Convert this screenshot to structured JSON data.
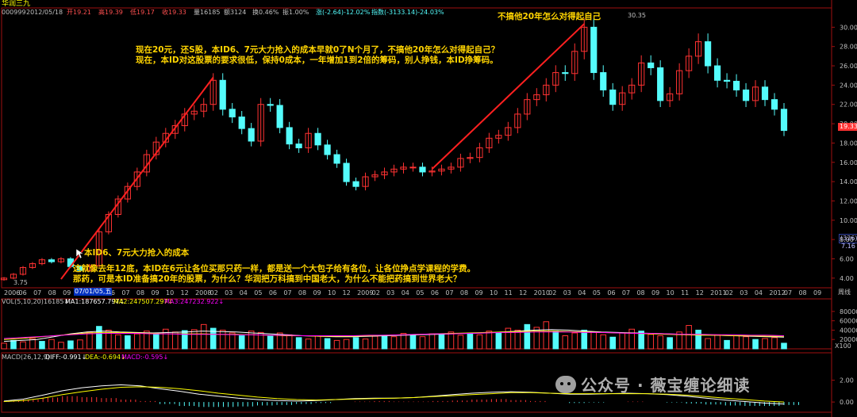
{
  "header": {
    "title": "华润三九",
    "code": "000999",
    "date": "2012/05/18",
    "open": "开19.21",
    "high": "高19.39",
    "low": "低19.17",
    "close": "收19.33",
    "volume": "量16185",
    "amount": "额3124",
    "turnover": "换0.46%",
    "amplitude": "振1.00%",
    "change": "涨(-2.64)-12.02%",
    "index": "指数(-3133.14)-24.03%"
  },
  "colors": {
    "up": "#ff3232",
    "down": "#54fcfc",
    "ma1": "#ffffff",
    "ma2": "#ffff00",
    "ma3": "#ff00ff",
    "trend": "#ff2020",
    "annotation": "#ffd400"
  },
  "annotations": {
    "top_line1": "现在20元，还S股，本ID6、7元大力抢入的成本早就0了N个月了，不搞他20年怎么对得起自己？",
    "top_line2": "现在，本ID对这股票的要求很低，保持0成本，一年增加1到2倍的筹码，别人挣钱，本ID挣筹码。",
    "peak_note": "不搞他20年怎么对得起自己",
    "entry_note": "本ID6、7元大力抢入的成本",
    "bottom_line1": "这就像去年12底，本ID在6元让各位买那只药一样，都是送一个大包子给有各位，让各位挣点学课程的学费。",
    "bottom_line2": "那药，可是本ID准备搞20年的股票，为什么？华润把万科搞到中国老大，为什么不能把药搞到世界老大？",
    "high_value": "30.35",
    "low_value": "3.75"
  },
  "price_badge": "19.33",
  "period_label": "(326)",
  "period_value": "7.16",
  "cursor_date": "07/01/05,五",
  "vol_panel": {
    "title": "VOL(5,10,20)",
    "value": "16185↓",
    "ma1": "MA1:187657.797↓",
    "ma2": "MA2:247507.297↓",
    "ma3": "MA3:247232.922↓",
    "scale_unit": "X100"
  },
  "macd_panel": {
    "title": "MACD(26,12,9)",
    "diff": "DIFF:-0.991↓",
    "dea": "DEA:-0.694↓",
    "macd": "MACD:-0.595↓"
  },
  "right_unit": "周线",
  "watermark": "公众号 · 薇宝缠论细读",
  "chart_data": [
    {
      "type": "candlestick",
      "title": "华润三九 周线",
      "ylim": [
        3,
        32
      ],
      "y_ticks": [
        "30.00",
        "28.00",
        "26.00",
        "24.00",
        "22.00",
        "20.00",
        "18.00",
        "16.00",
        "14.00",
        "12.00",
        "10.00",
        "8.00",
        "6.00",
        "4.00"
      ],
      "x_ticks": [
        "2006",
        "06",
        "07",
        "08",
        "09",
        "07/01/05,五",
        "05",
        "06",
        "07",
        "08",
        "09",
        "10",
        "12",
        "2008",
        "02",
        "03",
        "04",
        "05",
        "06",
        "07",
        "08",
        "09",
        "10",
        "12",
        "2009",
        "02",
        "03",
        "04",
        "05",
        "06",
        "07",
        "08",
        "09",
        "10",
        "11",
        "12",
        "2010",
        "02",
        "03",
        "04",
        "05",
        "06",
        "07",
        "08",
        "09",
        "10",
        "11",
        "12",
        "2011",
        "02",
        "03",
        "04",
        "2012",
        "07",
        "08",
        "09"
      ],
      "series": [
        {
          "name": "收盘",
          "values": [
            4.0,
            4.4,
            5.1,
            5.5,
            5.9,
            5.7,
            6.0,
            5.2,
            4.8,
            5.3,
            8.8,
            10.6,
            12.2,
            13.5,
            15.0,
            16.8,
            18.1,
            19.0,
            19.8,
            21.0,
            21.3,
            22.0,
            24.5,
            21.5,
            20.7,
            19.5,
            18.2,
            22.0,
            21.9,
            19.6,
            17.9,
            17.5,
            19.0,
            17.8,
            16.8,
            15.9,
            14.0,
            13.5,
            14.5,
            14.7,
            15.0,
            15.3,
            15.5,
            15.5,
            15.0,
            15.1,
            15.3,
            15.5,
            16.4,
            16.5,
            17.5,
            18.5,
            18.8,
            19.6,
            21.0,
            22.5,
            23.0,
            24.0,
            25.3,
            25.2,
            27.5,
            30.0,
            25.3,
            23.5,
            22.0,
            23.2,
            24.0,
            26.3,
            25.8,
            22.4,
            23.1,
            25.5,
            27.0,
            28.5,
            26.0,
            24.5,
            24.4,
            23.5,
            22.4,
            23.8,
            22.5,
            21.5,
            19.3
          ]
        }
      ],
      "trend_lines": [
        {
          "from": [
            3.8,
            "2006-09"
          ],
          "to": [
            24.6,
            "2007-09"
          ]
        },
        {
          "from": [
            15.4,
            "2009-09"
          ],
          "to": [
            30.35,
            "2010-05"
          ]
        }
      ]
    },
    {
      "type": "bar",
      "title": "VOL(5,10,20)",
      "y_ticks": [
        "80000",
        "60000",
        "40000",
        "20000"
      ],
      "ylim": [
        0,
        95000
      ],
      "series": [
        {
          "name": "VOL",
          "values": [
            12000,
            18000,
            15000,
            22000,
            16000,
            20000,
            14000,
            17000,
            19000,
            36000,
            48000,
            40000,
            30000,
            28000,
            32000,
            38000,
            34000,
            42000,
            36000,
            39000,
            41000,
            52000,
            44000,
            40000,
            34000,
            28000,
            38000,
            35000,
            27000,
            34000,
            30000,
            24000,
            21000,
            28000,
            22000,
            18000,
            20000,
            24000,
            21000,
            27000,
            29000,
            26000,
            33000,
            30000,
            26000,
            32000,
            31000,
            36000,
            29000,
            34000,
            30000,
            38000,
            34000,
            44000,
            40000,
            52000,
            46000,
            58000,
            38000,
            28000,
            34000,
            40000,
            36000,
            30000,
            25000,
            34000,
            42000,
            38000,
            31000,
            28000,
            24000,
            36000,
            50000,
            40000,
            22000,
            30000,
            18000,
            28000,
            26000,
            20000,
            22000,
            24000,
            12000
          ]
        },
        {
          "name": "MA1",
          "values": [
            16000,
            18000,
            20000,
            26000,
            32000,
            36000,
            38000,
            36000,
            35000,
            34000,
            35000,
            36000,
            38000,
            37000,
            36000,
            34000,
            32000,
            30000,
            28000,
            27000,
            26000,
            26000,
            27000,
            28000,
            29000,
            30000,
            31000,
            32000,
            33000,
            34000,
            36000,
            38000,
            40000,
            41000,
            40000,
            38000,
            36000,
            35000,
            34000,
            33000,
            32000,
            31000,
            30000,
            29000,
            28000,
            27000,
            26000,
            25000
          ]
        },
        {
          "name": "MA2",
          "values": [
            20000,
            22000,
            25000,
            28000,
            31000,
            34000,
            35000,
            35000,
            34000,
            33000,
            32000,
            32000,
            32000,
            31000,
            31000,
            30000,
            29000,
            28000,
            28000,
            27000,
            27000,
            27000,
            28000,
            29000,
            30000,
            31000,
            32000,
            33000,
            34000,
            35000,
            36000,
            37000,
            38000,
            38000,
            37000,
            36000,
            35000,
            34000,
            33000,
            32000,
            31000,
            30000,
            29000,
            29000,
            28000,
            28000,
            27000,
            27000
          ]
        },
        {
          "name": "MA3",
          "values": [
            22000,
            24000,
            26000,
            28000,
            30000,
            32000,
            33000,
            33000,
            33000,
            32000,
            32000,
            31000,
            31000,
            31000,
            30000,
            30000,
            29000,
            29000,
            28000,
            28000,
            28000,
            28000,
            29000,
            29000,
            30000,
            31000,
            32000,
            32000,
            33000,
            34000,
            35000,
            35000,
            36000,
            36000,
            36000,
            35000,
            35000,
            34000,
            33000,
            33000,
            32000,
            31000,
            31000,
            30000,
            30000,
            29000,
            29000,
            28000
          ]
        }
      ]
    },
    {
      "type": "line",
      "title": "MACD(26,12,9)",
      "y_ticks": [
        "2.00",
        "0.00"
      ],
      "ylim": [
        -0.5,
        4.0
      ],
      "series": [
        {
          "name": "DIFF",
          "values": [
            0.2,
            0.6,
            1.4,
            2.3,
            2.9,
            3.3,
            3.5,
            3.3,
            2.7,
            2.2,
            1.6,
            1.2,
            0.8,
            0.5,
            0.3,
            0.2,
            0.3,
            0.5,
            0.7,
            0.8,
            0.8,
            0.9,
            1.2,
            1.5,
            1.8,
            2.0,
            2.1,
            2.0,
            1.8,
            1.6,
            1.6,
            1.7,
            1.8,
            1.7,
            1.5,
            1.2,
            0.8,
            0.4,
            0.1,
            -0.2,
            -0.4
          ]
        },
        {
          "name": "DEA",
          "values": [
            0.1,
            0.3,
            0.8,
            1.5,
            2.1,
            2.6,
            3.0,
            3.1,
            3.0,
            2.7,
            2.3,
            1.8,
            1.4,
            1.0,
            0.7,
            0.5,
            0.4,
            0.5,
            0.6,
            0.7,
            0.8,
            0.9,
            1.1,
            1.3,
            1.5,
            1.7,
            1.9,
            1.9,
            1.8,
            1.7,
            1.7,
            1.7,
            1.7,
            1.7,
            1.6,
            1.4,
            1.1,
            0.8,
            0.5,
            0.2,
            0.0
          ]
        },
        {
          "name": "MACD",
          "values": [
            0.2,
            0.5,
            0.9,
            1.2,
            1.0,
            0.8,
            0.5,
            0.2,
            -0.4,
            -0.8,
            -1.0,
            -1.0,
            -0.9,
            -0.7,
            -0.6,
            -0.4,
            -0.2,
            0.0,
            0.1,
            0.2,
            0.1,
            0.1,
            0.2,
            0.3,
            0.5,
            0.6,
            0.4,
            0.2,
            0.0,
            -0.2,
            -0.1,
            0.0,
            0.1,
            0.0,
            -0.1,
            -0.3,
            -0.5,
            -0.7,
            -0.8,
            -0.8,
            -0.6
          ]
        }
      ]
    }
  ]
}
